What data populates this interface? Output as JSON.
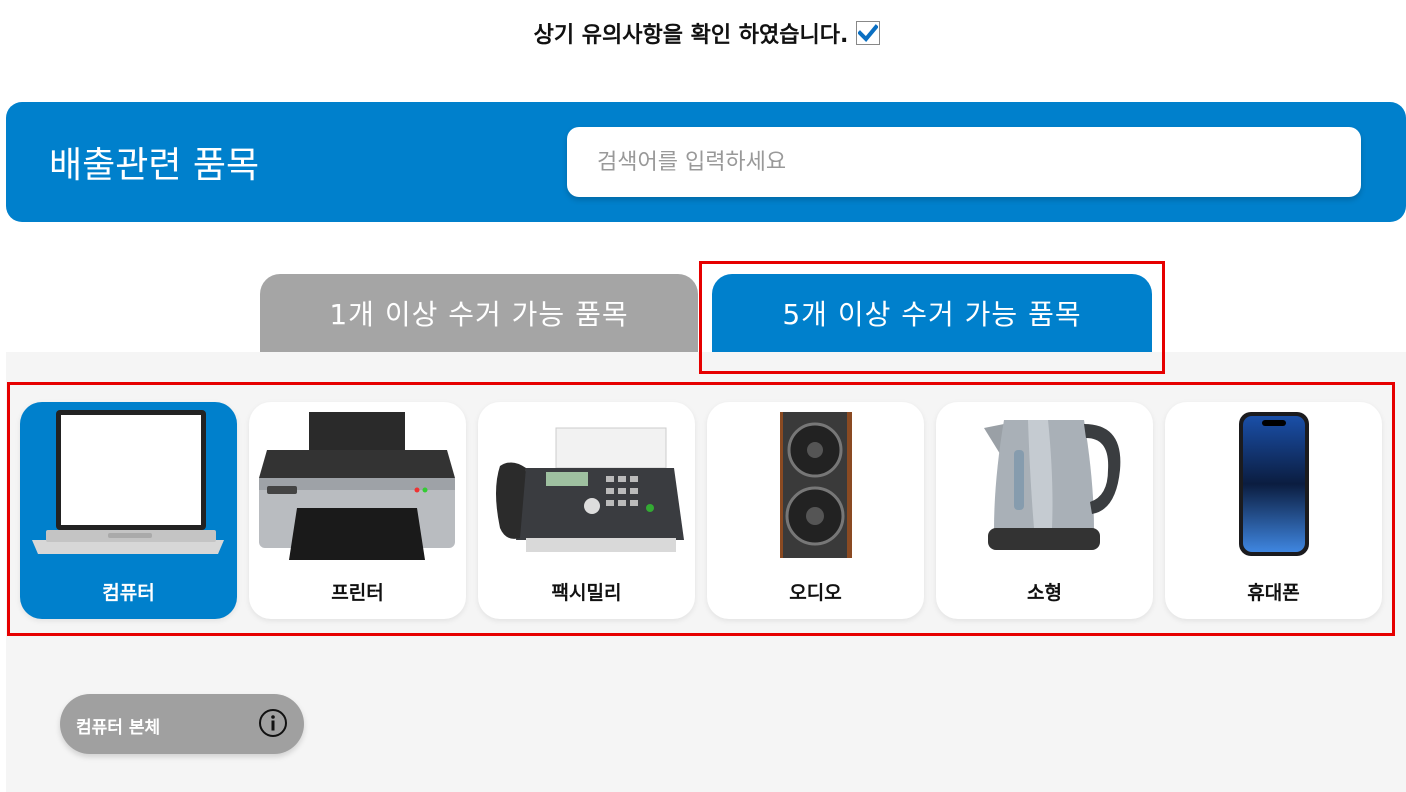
{
  "consent": {
    "text": "상기 유의사항을 확인 하였습니다.",
    "checked": true
  },
  "header": {
    "title": "배출관련 품목",
    "search_placeholder": "검색어를 입력하세요",
    "colors": {
      "brand": "#0080cc"
    }
  },
  "tabs": [
    {
      "label": "1개 이상 수거 가능 품목",
      "active": false
    },
    {
      "label": "5개 이상 수거 가능 품목",
      "active": true
    }
  ],
  "categories": [
    {
      "label": "컴퓨터",
      "icon": "laptop-image",
      "active": true
    },
    {
      "label": "프린터",
      "icon": "printer-image",
      "active": false
    },
    {
      "label": "팩시밀리",
      "icon": "fax-machine-image",
      "active": false
    },
    {
      "label": "오디오",
      "icon": "speaker-image",
      "active": false
    },
    {
      "label": "소형",
      "icon": "electric-kettle-image",
      "active": false
    },
    {
      "label": "휴대폰",
      "icon": "smartphone-image",
      "active": false
    }
  ],
  "items": [
    {
      "label": "컴퓨터 본체",
      "icon": "info-icon"
    }
  ],
  "colors": {
    "accent": "#0080cc",
    "inactive_tab": "#a5a5a5",
    "highlight": "#e60000",
    "chip": "#a0a0a0"
  }
}
